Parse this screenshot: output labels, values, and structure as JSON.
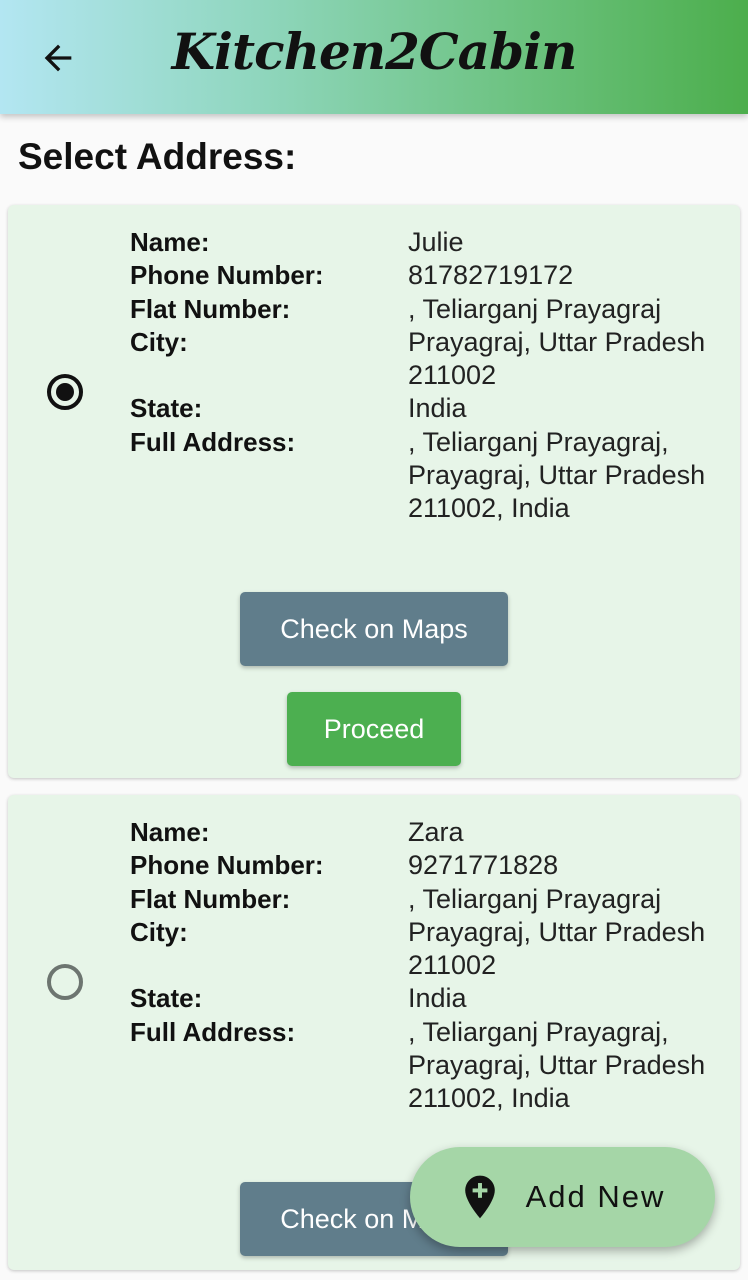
{
  "app": {
    "title": "Kitchen2Cabin"
  },
  "page": {
    "heading": "Select Address:"
  },
  "field_labels": {
    "name": "Name:",
    "phone": "Phone Number:",
    "flat": "Flat Number:",
    "city": "City:",
    "state": "State:",
    "full_address": "Full Address:"
  },
  "addresses": [
    {
      "selected": true,
      "name": "Julie",
      "phone": "81782719172",
      "flat": ", Teliarganj Prayagraj",
      "city": "Prayagraj, Uttar Pradesh 211002",
      "state": "India",
      "full_address": ", Teliarganj Prayagraj, Prayagraj, Uttar Pradesh 211002, India",
      "maps_label": "Check on Maps",
      "proceed_label": "Proceed"
    },
    {
      "selected": false,
      "name": "Zara",
      "phone": "9271771828",
      "flat": ", Teliarganj Prayagraj",
      "city": "Prayagraj, Uttar Pradesh 211002",
      "state": "India",
      "full_address": ", Teliarganj Prayagraj, Prayagraj, Uttar Pradesh 211002, India",
      "maps_label": "Check on Maps"
    }
  ],
  "fab": {
    "label": "Add New",
    "icon": "add-location-icon"
  },
  "colors": {
    "card_bg": "#e7f5e8",
    "maps_button": "#607d8b",
    "proceed_button": "#4caf50",
    "fab_bg": "#a5d6a7"
  }
}
